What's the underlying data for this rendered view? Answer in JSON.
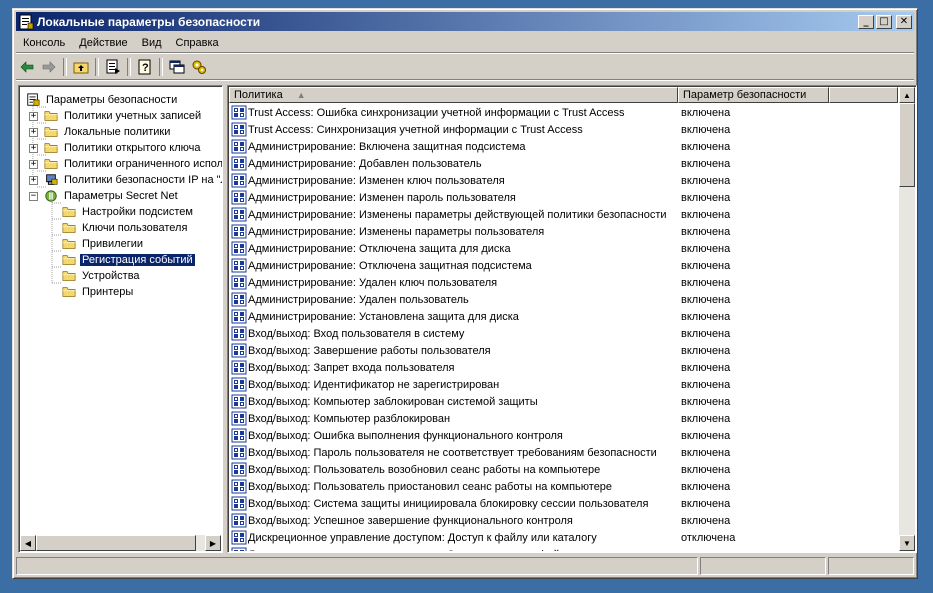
{
  "window": {
    "title": "Локальные параметры безопасности",
    "controls": [
      "minimize",
      "maximize",
      "close"
    ]
  },
  "menu": [
    "Консоль",
    "Действие",
    "Вид",
    "Справка"
  ],
  "toolbar": [
    "back-icon",
    "forward-icon",
    "up-folder-icon",
    "export-list-icon",
    "help-icon",
    "new-window-icon",
    "properties-icon"
  ],
  "tree": {
    "items": [
      {
        "label": "Параметры безопасности",
        "level": 0,
        "expander": "",
        "icon": "security-settings-icon"
      },
      {
        "label": "Политики учетных записей",
        "level": 1,
        "expander": "+",
        "icon": "folder-icon"
      },
      {
        "label": "Локальные политики",
        "level": 1,
        "expander": "+",
        "icon": "folder-icon"
      },
      {
        "label": "Политики открытого ключа",
        "level": 1,
        "expander": "+",
        "icon": "folder-icon"
      },
      {
        "label": "Политики ограниченного испол",
        "level": 1,
        "expander": "+",
        "icon": "folder-icon"
      },
      {
        "label": "Политики безопасности IP на \"Л",
        "level": 1,
        "expander": "+",
        "icon": "ip-security-icon"
      },
      {
        "label": "Параметры Secret Net",
        "level": 1,
        "expander": "−",
        "icon": "secret-net-icon"
      },
      {
        "label": "Настройки подсистем",
        "level": 2,
        "expander": "",
        "icon": "folder-icon"
      },
      {
        "label": "Ключи пользователя",
        "level": 2,
        "expander": "",
        "icon": "folder-icon"
      },
      {
        "label": "Привилегии",
        "level": 2,
        "expander": "",
        "icon": "folder-icon"
      },
      {
        "label": "Регистрация событий",
        "level": 2,
        "expander": "",
        "icon": "folder-icon",
        "selected": true
      },
      {
        "label": "Устройства",
        "level": 2,
        "expander": "",
        "icon": "folder-icon"
      },
      {
        "label": "Принтеры",
        "level": 2,
        "expander": "",
        "icon": "folder-icon"
      }
    ]
  },
  "list": {
    "columns": [
      "Политика",
      "Параметр безопасности"
    ],
    "rows": [
      {
        "policy": "Trust Access: Ошибка синхронизации учетной информации с Trust Access",
        "value": "включена"
      },
      {
        "policy": "Trust Access: Синхронизация учетной информации с Trust Access",
        "value": "включена"
      },
      {
        "policy": "Администрирование: Включена защитная подсистема",
        "value": "включена"
      },
      {
        "policy": "Администрирование: Добавлен пользователь",
        "value": "включена"
      },
      {
        "policy": "Администрирование: Изменен ключ пользователя",
        "value": "включена"
      },
      {
        "policy": "Администрирование: Изменен пароль пользователя",
        "value": "включена"
      },
      {
        "policy": "Администрирование: Изменены параметры действующей политики безопасности",
        "value": "включена"
      },
      {
        "policy": "Администрирование: Изменены параметры пользователя",
        "value": "включена"
      },
      {
        "policy": "Администрирование: Отключена защита для диска",
        "value": "включена"
      },
      {
        "policy": "Администрирование: Отключена защитная подсистема",
        "value": "включена"
      },
      {
        "policy": "Администрирование: Удален ключ пользователя",
        "value": "включена"
      },
      {
        "policy": "Администрирование: Удален пользователь",
        "value": "включена"
      },
      {
        "policy": "Администрирование: Установлена защита для диска",
        "value": "включена"
      },
      {
        "policy": "Вход/выход: Вход пользователя в систему",
        "value": "включена"
      },
      {
        "policy": "Вход/выход: Завершение работы пользователя",
        "value": "включена"
      },
      {
        "policy": "Вход/выход: Запрет входа пользователя",
        "value": "включена"
      },
      {
        "policy": "Вход/выход: Идентификатор не зарегистрирован",
        "value": "включена"
      },
      {
        "policy": "Вход/выход: Компьютер заблокирован системой защиты",
        "value": "включена"
      },
      {
        "policy": "Вход/выход: Компьютер разблокирован",
        "value": "включена"
      },
      {
        "policy": "Вход/выход: Ошибка выполнения функционального контроля",
        "value": "включена"
      },
      {
        "policy": "Вход/выход: Пароль пользователя не соответствует требованиям безопасности",
        "value": "включена"
      },
      {
        "policy": "Вход/выход: Пользователь возобновил сеанс работы на компьютере",
        "value": "включена"
      },
      {
        "policy": "Вход/выход: Пользователь приостановил сеанс работы на компьютере",
        "value": "включена"
      },
      {
        "policy": "Вход/выход: Система защиты инициировала блокировку сессии пользователя",
        "value": "включена"
      },
      {
        "policy": "Вход/выход: Успешное завершение функционального контроля",
        "value": "включена"
      },
      {
        "policy": "Дискреционное управление доступом: Доступ к файлу или каталогу",
        "value": "отключена"
      },
      {
        "policy": "Дискреционное управление доступом: Запрет доступа к файлу или каталогу",
        "value": "включена"
      }
    ]
  },
  "colors": {
    "desktop": "#3a6ea5",
    "title_start": "#0a246a",
    "title_end": "#a6caf0",
    "face": "#d4d0c8",
    "selection": "#0a246a"
  }
}
